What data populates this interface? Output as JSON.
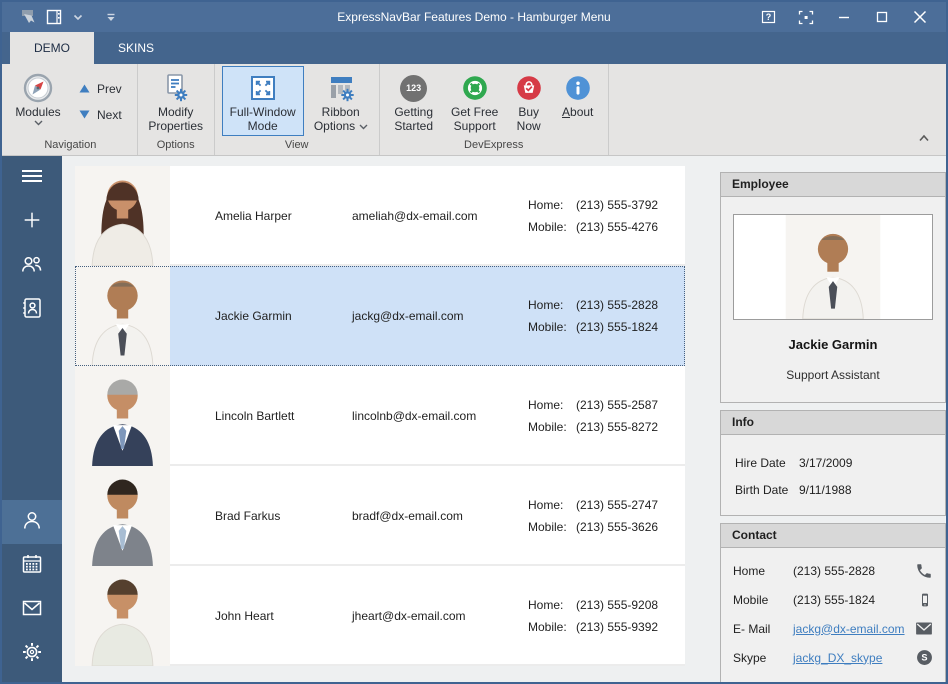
{
  "colors": {
    "titlebar": "#4c6e99",
    "tabstrip": "#44658d",
    "sidebar": "#3d5a7a",
    "sidebar_selected": "#4d7096",
    "accent_blue": "#3f7ec0",
    "selected_row": "#cfe1f7",
    "link": "#3f7ec0",
    "support_green": "#2fa84f",
    "buy_red": "#d63a46",
    "getting_gray": "#717171",
    "about_blue": "#4f92d6"
  },
  "titlebar": {
    "title": "ExpressNavBar Features Demo - Hamburger Menu"
  },
  "tabs": [
    {
      "label": "DEMO",
      "active": true
    },
    {
      "label": "SKINS",
      "active": false
    }
  ],
  "ribbon": {
    "modules_label": "Modules",
    "prev_label": "Prev",
    "next_label": "Next",
    "modify_label": "Modify Properties",
    "fullwindow_label": "Full-Window Mode",
    "ribbonoptions_label": "Ribbon Options",
    "getting_label": "Getting Started",
    "getting_badge": "123",
    "getfree_label": "Get Free Support",
    "buynow_label": "Buy Now",
    "about_label": "About",
    "groups": {
      "navigation": "Navigation",
      "options": "Options",
      "view": "View",
      "devexpress": "DevExpress"
    }
  },
  "sidebar": {
    "items": [
      "hamburger",
      "plus",
      "people",
      "address-book",
      "person",
      "calendar",
      "mail",
      "gear"
    ],
    "selected": "person",
    "gap_before": "person"
  },
  "list": {
    "home_label": "Home:",
    "mobile_label": "Mobile:",
    "employees": [
      {
        "name": "Amelia Harper",
        "email": "ameliah@dx-email.com",
        "home": "(213) 555-3792",
        "mobile": "(213) 555-4276",
        "selected": false,
        "photo": {
          "style": "long",
          "hair": "#4f3226",
          "skin": "#c9906a",
          "shirt": "#efece6"
        }
      },
      {
        "name": "Jackie Garmin",
        "email": "jackg@dx-email.com",
        "home": "(213) 555-2828",
        "mobile": "(213) 555-1824",
        "selected": true,
        "photo": {
          "style": "bald",
          "hair": "#7d6a58",
          "skin": "#b07d55",
          "shirt": "#f3f2ef",
          "tie": "#4b4f58"
        }
      },
      {
        "name": "Lincoln Bartlett",
        "email": "lincolnb@dx-email.com",
        "home": "(213) 555-2587",
        "mobile": "(213) 555-8272",
        "selected": false,
        "photo": {
          "style": "short",
          "hair": "#a9a9a7",
          "skin": "#c58e66",
          "shirt": "#ffffff",
          "suit": "#35415a",
          "tie": "#7e97bb"
        }
      },
      {
        "name": "Brad Farkus",
        "email": "bradf@dx-email.com",
        "home": "(213) 555-2747",
        "mobile": "(213) 555-3626",
        "selected": false,
        "photo": {
          "style": "short",
          "hair": "#2f261f",
          "skin": "#bf8a60",
          "shirt": "#ffffff",
          "suit": "#7e838b",
          "tie": "#a8bdd3"
        }
      },
      {
        "name": "John Heart",
        "email": "jheart@dx-email.com",
        "home": "(213) 555-9208",
        "mobile": "(213) 555-9392",
        "selected": false,
        "photo": {
          "style": "short",
          "hair": "#55402e",
          "skin": "#c79067",
          "shirt": "#e8eae2"
        }
      }
    ]
  },
  "detail": {
    "employee_header": "Employee",
    "name": "Jackie Garmin",
    "title": "Support Assistant",
    "info_header": "Info",
    "info_rows": [
      {
        "label": "Hire Date",
        "value": "3/17/2009"
      },
      {
        "label": "Birth Date",
        "value": "9/11/1988"
      }
    ],
    "contact_header": "Contact",
    "contact_rows": [
      {
        "label": "Home",
        "value": "(213) 555-2828",
        "icon": "phone",
        "link": false
      },
      {
        "label": "Mobile",
        "value": "(213) 555-1824",
        "icon": "mobile",
        "link": false
      },
      {
        "label": "E- Mail",
        "value": "jackg@dx-email.com",
        "icon": "envelope",
        "link": true
      },
      {
        "label": "Skype",
        "value": "jackg_DX_skype",
        "icon": "skype",
        "link": true
      }
    ],
    "photo": {
      "style": "bald",
      "hair": "#7d6a58",
      "skin": "#b07d55",
      "shirt": "#f3f2ef",
      "tie": "#4b4f58"
    }
  }
}
